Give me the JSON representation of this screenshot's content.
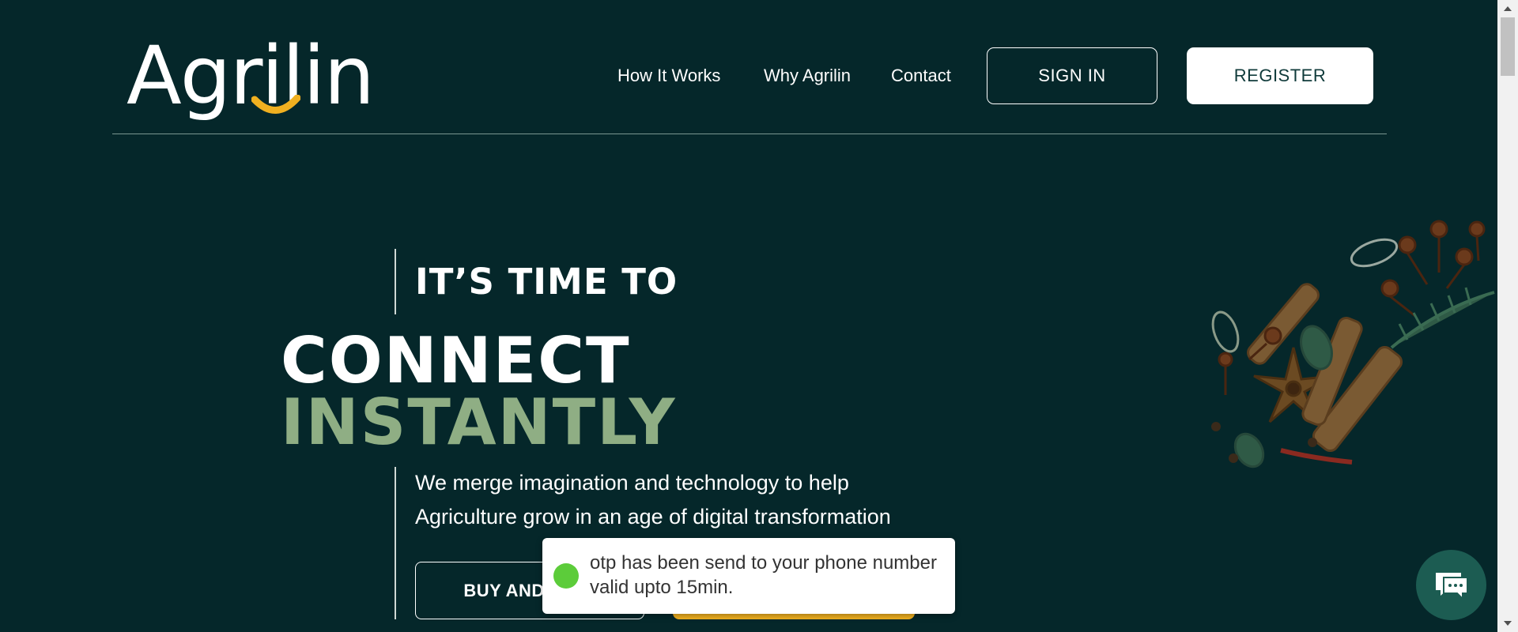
{
  "header": {
    "logo_text": "Agrilin",
    "nav": [
      {
        "label": "How It Works"
      },
      {
        "label": "Why Agrilin"
      },
      {
        "label": "Contact"
      }
    ],
    "sign_in_label": "SIGN IN",
    "register_label": "REGISTER"
  },
  "hero": {
    "eyebrow": "IT’S TIME TO",
    "headline_line1": "CONNECT",
    "headline_line2": "INSTANTLY",
    "subtext_line1": "We merge imagination and technology to help",
    "subtext_line2": "Agriculture grow in an age of digital transformation",
    "primary_button_label": "BUY AND SELL",
    "secondary_button_label": ""
  },
  "toast": {
    "message": "otp has been send to your phone number valid upto 15min.",
    "status": "success",
    "status_color": "#5ccc3a"
  },
  "chat": {
    "icon": "chat-bubble-icon"
  },
  "colors": {
    "background": "#05272a",
    "accent_green": "#8fae84",
    "accent_yellow": "#f0b020",
    "logo_smile": "#f0b020"
  },
  "decoration": {
    "illustration": "spices-illustration"
  }
}
